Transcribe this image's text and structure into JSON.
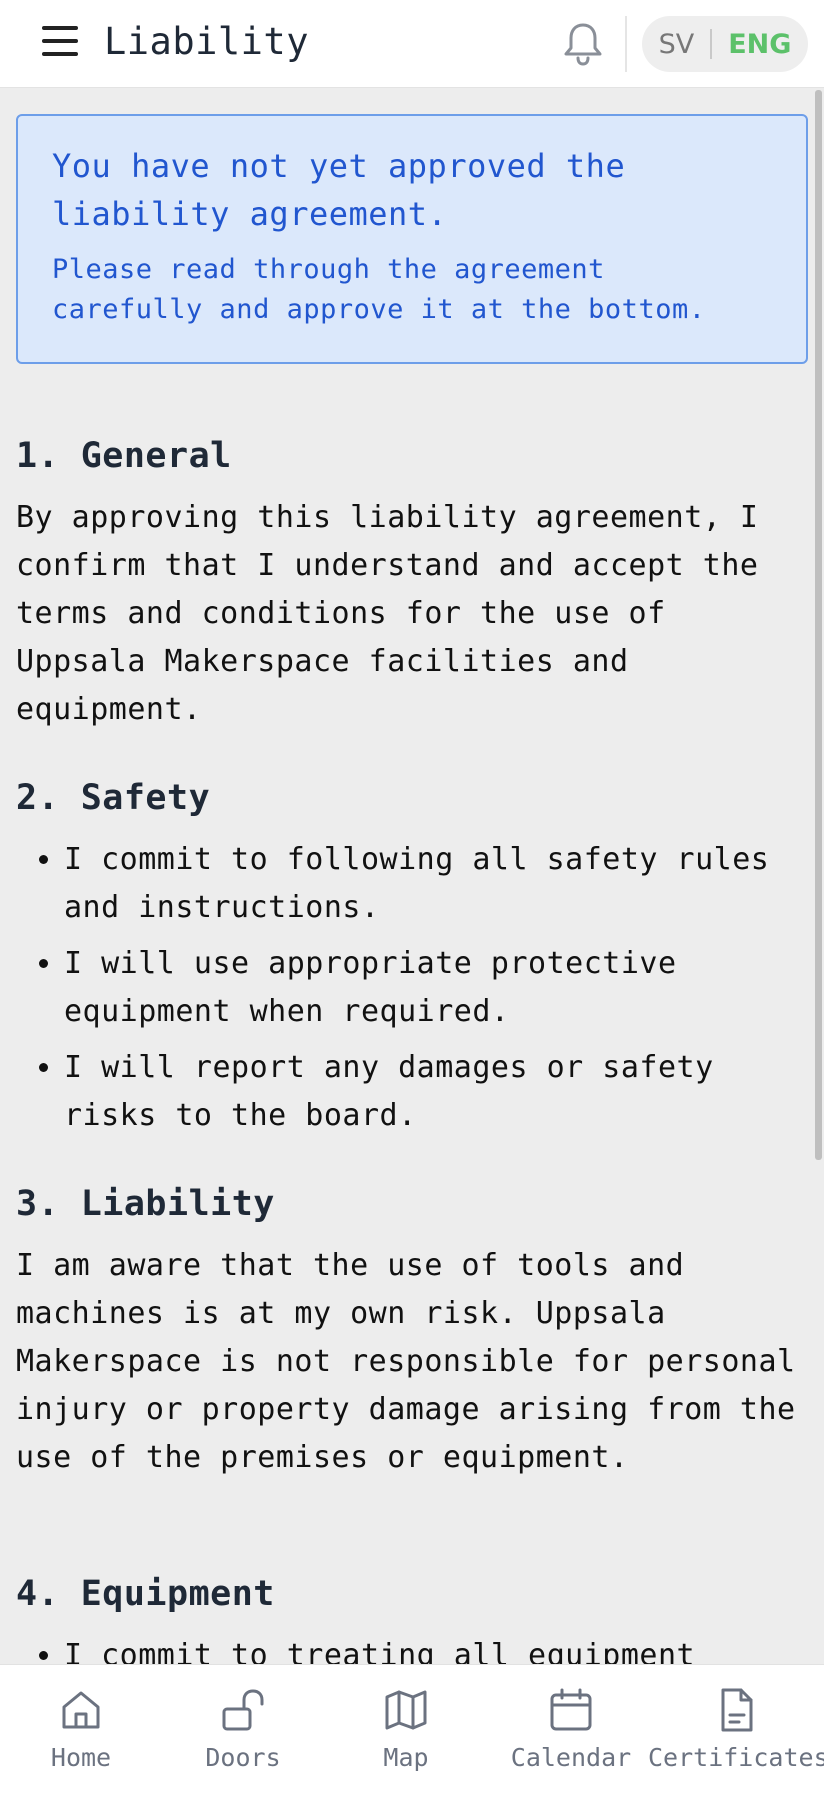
{
  "header": {
    "title": "Liability",
    "lang_sv": "SV",
    "lang_eng": "ENG"
  },
  "alert": {
    "title": "You have not yet approved the liability agreement.",
    "body": "Please read through the agreement carefully and approve it at the bottom."
  },
  "sections": [
    {
      "heading": "1. General",
      "text": "By approving this liability agreement, I confirm that I understand and accept the terms and conditions for the use of Uppsala Makerspace facilities and equipment."
    },
    {
      "heading": "2. Safety",
      "items": [
        "I commit to following all safety rules and instructions.",
        "I will use appropriate protective equipment when required.",
        "I will report any damages or safety risks to the board."
      ]
    },
    {
      "heading": "3. Liability",
      "text": "I am aware that the use of tools and machines is at my own risk. Uppsala Makerspace is not responsible for personal injury or property damage arising from the use of the premises or equipment."
    },
    {
      "heading": "4. Equipment",
      "items": [
        "I commit to treating all equipment"
      ]
    }
  ],
  "nav": [
    {
      "label": "Home",
      "icon": "home-icon"
    },
    {
      "label": "Doors",
      "icon": "unlock-icon"
    },
    {
      "label": "Map",
      "icon": "map-icon"
    },
    {
      "label": "Calendar",
      "icon": "calendar-icon"
    },
    {
      "label": "Certificates",
      "icon": "document-icon"
    }
  ],
  "colors": {
    "alert_bg": "#dbe8fb",
    "alert_border": "#6d9ee9",
    "alert_text": "#2156cf",
    "lang_active": "#5cc16a",
    "nav_text": "#6b7280"
  }
}
